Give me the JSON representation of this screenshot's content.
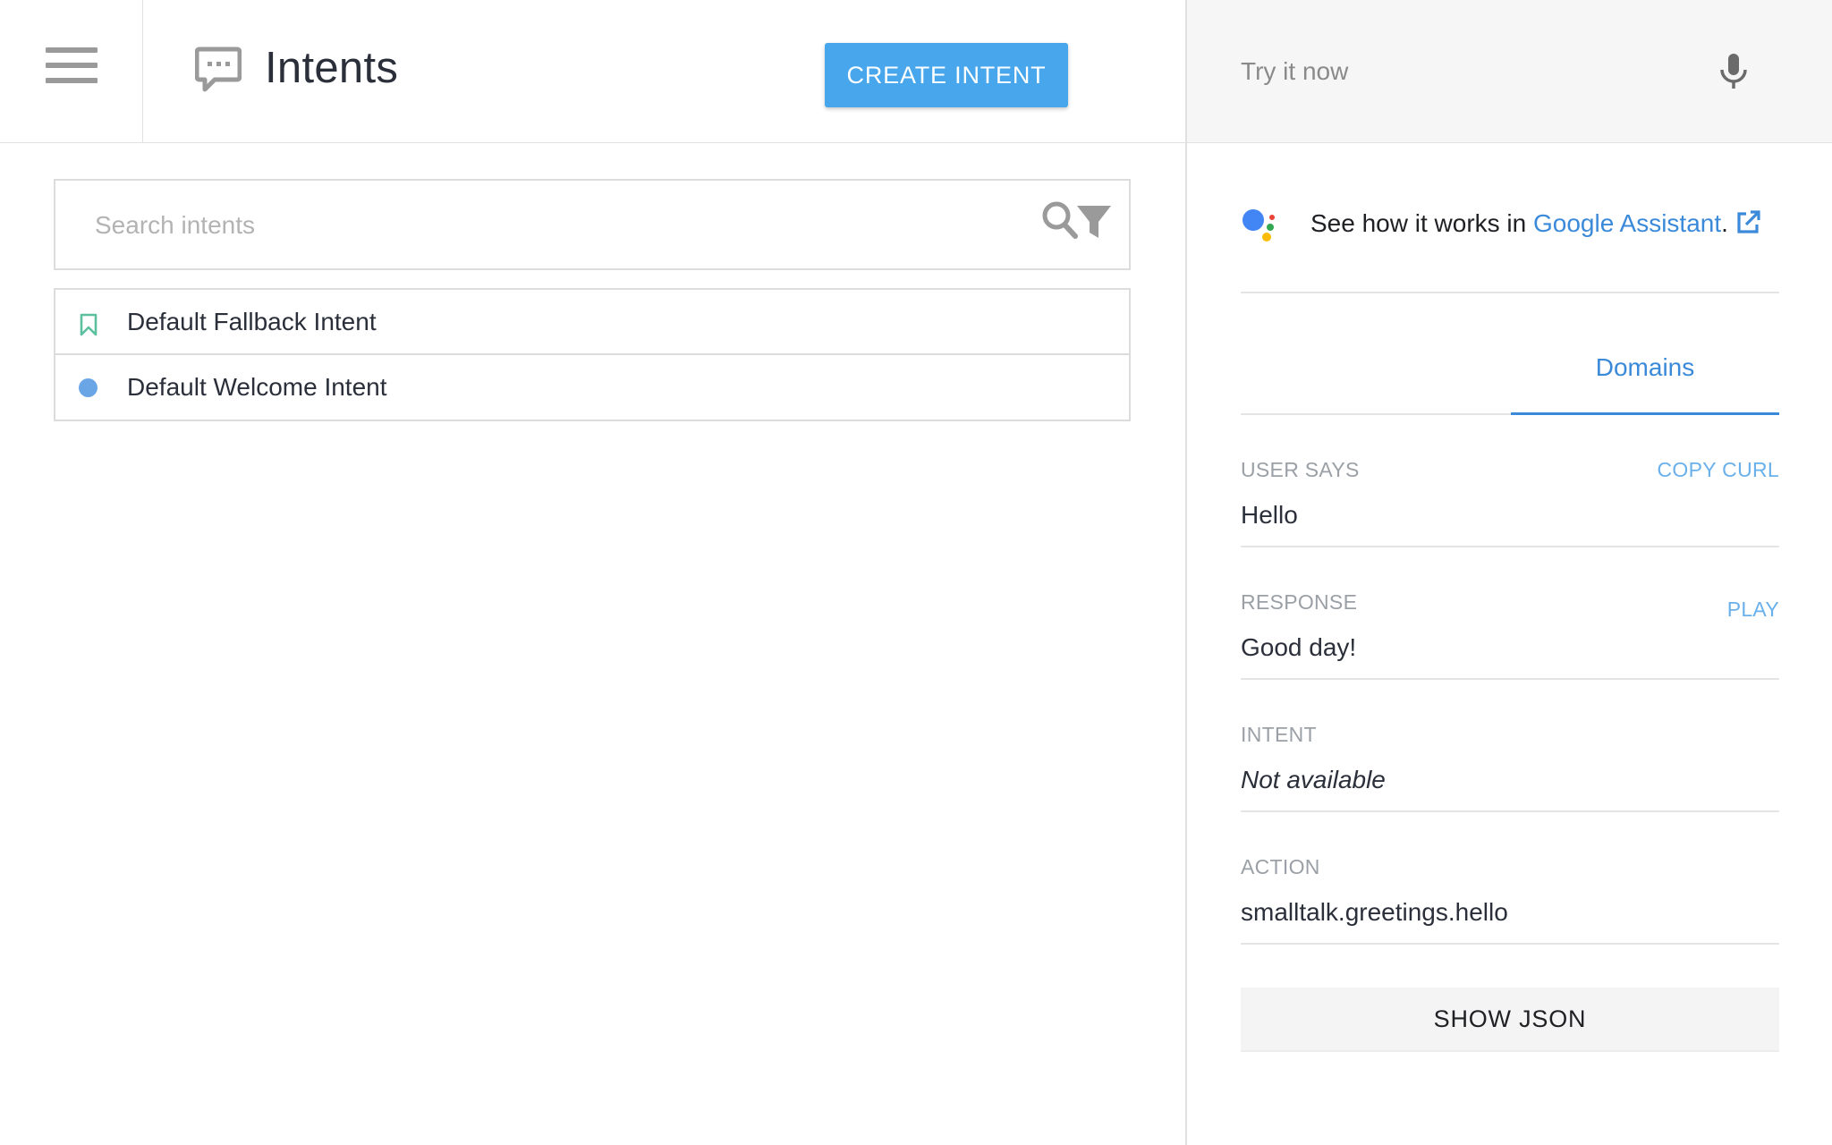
{
  "header": {
    "title": "Intents",
    "create_label": "CREATE INTENT"
  },
  "search": {
    "placeholder": "Search intents"
  },
  "intents": [
    {
      "label": "Default Fallback Intent",
      "icon": "bookmark-icon"
    },
    {
      "label": "Default Welcome Intent",
      "icon": "dot-icon"
    }
  ],
  "try_panel": {
    "placeholder": "Try it now",
    "assistant_prefix": "See how it works in ",
    "assistant_link": "Google Assistant",
    "assistant_suffix": ".",
    "tab_label": "Domains",
    "user_says_label": "USER SAYS",
    "copy_curl_label": "COPY CURL",
    "user_says_value": "Hello",
    "response_label": "RESPONSE",
    "play_label": "PLAY",
    "response_value": "Good day!",
    "intent_label": "INTENT",
    "intent_value": "Not available",
    "action_label": "ACTION",
    "action_value": "smalltalk.greetings.hello",
    "show_json_label": "SHOW JSON"
  },
  "colors": {
    "accent": "#47a6ec",
    "link": "#3b8ad9",
    "fallback_icon": "#5cc0a0",
    "welcome_dot": "#6aa6e6"
  }
}
